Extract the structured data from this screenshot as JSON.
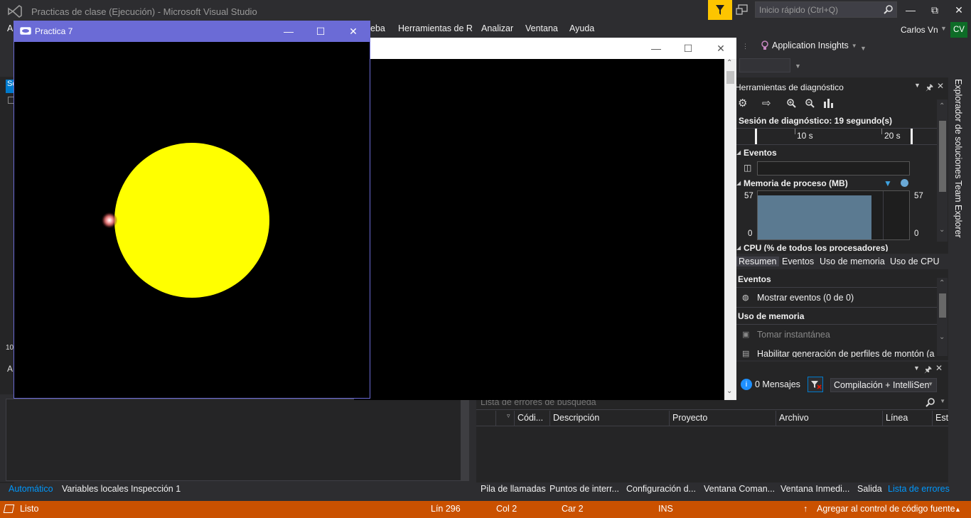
{
  "vs": {
    "title": "Practicas de clase (Ejecución) - Microsoft Visual Studio",
    "quick_launch_placeholder": "Inicio rápido (Ctrl+Q)",
    "user_name": "Carlos Vn",
    "user_initials": "CV",
    "menu": [
      "eba",
      "Herramientas de R",
      "Analizar",
      "Ventana",
      "Ayuda"
    ],
    "app_insights": "Application Insights",
    "left_tab_fragment": "So",
    "left_fragment_number": "10",
    "left_fragment_letter": "A",
    "bottom_left_tabs": [
      "Automático",
      "Variables locales",
      "Inspección 1"
    ]
  },
  "glut_window": {
    "title": "Practica 7",
    "colors": {
      "title_bar": "#6b6bd6",
      "sun": "#ffff00",
      "background": "#000000"
    }
  },
  "diagnostics": {
    "title": "Herramientas de diagnóstico",
    "session": "Sesión de diagnóstico: 19 segundo(s)",
    "ruler_labels": [
      "10 s",
      "20 s"
    ],
    "events_title": "Eventos",
    "memory_title": "Memoria de proceso (MB)",
    "memory_max": "57",
    "memory_min": "0",
    "cpu_title": "CPU (% de todos los procesadores)",
    "tabs": [
      "Resumen",
      "Eventos",
      "Uso de memoria",
      "Uso de CPU"
    ],
    "summary_events_heading": "Eventos",
    "show_events": "Mostrar eventos (0 de 0)",
    "memory_usage_heading": "Uso de memoria",
    "take_snapshot": "Tomar instantánea",
    "heap_profiling": "Habilitar generación de perfiles de montón (a"
  },
  "side_tabs": [
    "Explorador de soluciones",
    "Team Explorer"
  ],
  "error_list": {
    "messages": "0 Mensajes",
    "build_filter": "Compilación + IntelliSen",
    "search_placeholder": "Lista de errores de búsqueda",
    "columns": [
      "Códi...",
      "Descripción",
      "Proyecto",
      "Archivo",
      "Línea",
      "Esta"
    ],
    "bottom_tabs": [
      "Pila de llamadas",
      "Puntos de interr...",
      "Configuración d...",
      "Ventana Coman...",
      "Ventana Inmedi...",
      "Salida",
      "Lista de errores"
    ]
  },
  "statusbar": {
    "status": "Listo",
    "line": "Lín 296",
    "col": "Col 2",
    "char": "Car 2",
    "mode": "INS",
    "source_control": "Agregar al control de código fuente",
    "color": "#ca5100"
  }
}
